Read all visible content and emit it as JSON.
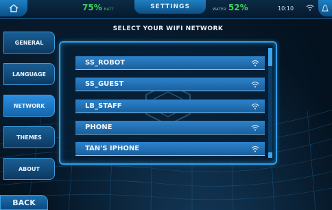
{
  "topbar": {
    "battery_percent": "75%",
    "battery_label": "BATT",
    "screen_title": "SETTINGS",
    "water_label": "WATER",
    "water_percent": "52%",
    "time": "10:10"
  },
  "sidebar": {
    "items": [
      {
        "label": "GENERAL"
      },
      {
        "label": "LANGUAGE"
      },
      {
        "label": "NETWORK"
      },
      {
        "label": "THEMES"
      },
      {
        "label": "ABOUT"
      }
    ],
    "active": "NETWORK",
    "back_label": "BACK"
  },
  "wifi": {
    "title": "SELECT YOUR WIFI NETWORK",
    "networks": [
      {
        "name": "SS_ROBOT"
      },
      {
        "name": "SS_GUEST"
      },
      {
        "name": "LB_STAFF"
      },
      {
        "name": "PHONE"
      },
      {
        "name": "TAN'S IPHONE"
      }
    ]
  },
  "colors": {
    "accent": "#2e9fe8",
    "status_green": "#3fd05d",
    "background": "#04121f"
  },
  "icons": [
    "home-icon",
    "wifi-icon",
    "alert-icon",
    "hexagon-logo-icon"
  ]
}
